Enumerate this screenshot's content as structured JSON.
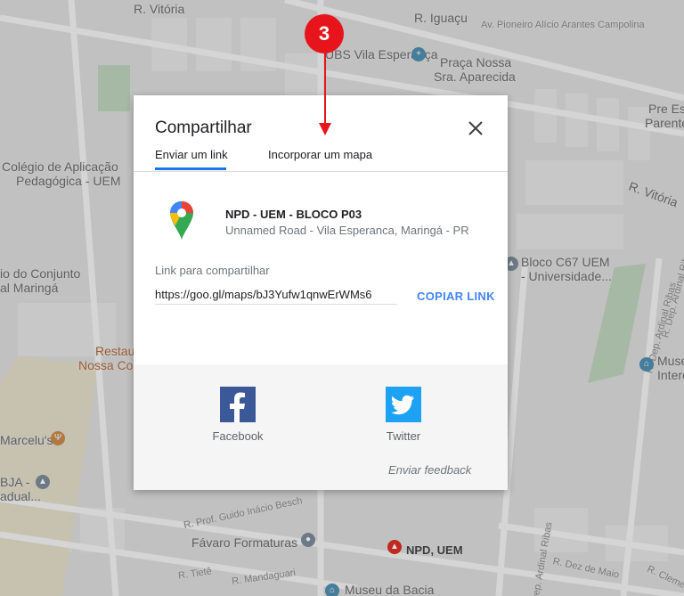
{
  "map": {
    "labels": {
      "r_vitoria_top": "R. Vitória",
      "r_iguacu": "R. Iguaçu",
      "av_pioneiro": "Av. Pioneiro Alício Arantes Campolina",
      "ubs": "UBS Vila Esperança",
      "praca_1": "Praça Nossa",
      "praca_2": "Sra. Aparecida",
      "pre_es_1": "Pre Es",
      "pre_es_2": "Parente",
      "colegio_1": "Colégio de Aplicação",
      "colegio_2": "Pedagógica - UEM",
      "r_vitoria_right": "R. Vitória",
      "conjunto_1": "io do Conjunto",
      "conjunto_2": "al Maringá",
      "bloco_1": "Bloco C67 UEM",
      "bloco_2": "- Universidade...",
      "r_dep_ardinal_1": "R. Dep. Ardinal Ribas",
      "r_dep_ardinal_2": "R. Dep. Ardinal Ribas",
      "restau_1": "Restau",
      "restau_2": "Nossa Co",
      "museu_1": "Muse",
      "museu_2": "Intere",
      "marcelus": "Marcelu's",
      "bja_1": "BJA -",
      "bja_2": "adual...",
      "r_guido": "R. Prof. Guido Inácio Besch",
      "favaro": "Fávaro Formaturas",
      "npd_uem": "NPD, UEM",
      "r_tiete": "R. Tietê",
      "r_mandaguari": "R. Mandaguari",
      "r_dez_maio": "R. Dez de Maio",
      "r_clemente": "R. Cleme",
      "museu_bacia": "Museu da Bacia",
      "r_ardinal_bottom": "R. Dep. Ardinal Ribas"
    }
  },
  "annotation": {
    "step_number": "3"
  },
  "dialog": {
    "title": "Compartilhar",
    "tabs": [
      {
        "label": "Enviar um link"
      },
      {
        "label": "Incorporar um mapa"
      }
    ],
    "place": {
      "name": "NPD - UEM - BLOCO P03",
      "address": "Unnamed Road - Vila Esperanca, Maringá - PR"
    },
    "link_label": "Link para compartilhar",
    "link_value": "https://goo.gl/maps/bJ3Yufw1qnwErWMs6",
    "copy_label": "COPIAR LINK",
    "social": {
      "facebook_label": "Facebook",
      "twitter_label": "Twitter"
    },
    "feedback_label": "Enviar feedback"
  },
  "colors": {
    "accent": "#1a73e8",
    "copy_link": "#4285f4",
    "facebook": "#3b5998",
    "twitter": "#1da1f2",
    "annotation": "#e8141c"
  }
}
